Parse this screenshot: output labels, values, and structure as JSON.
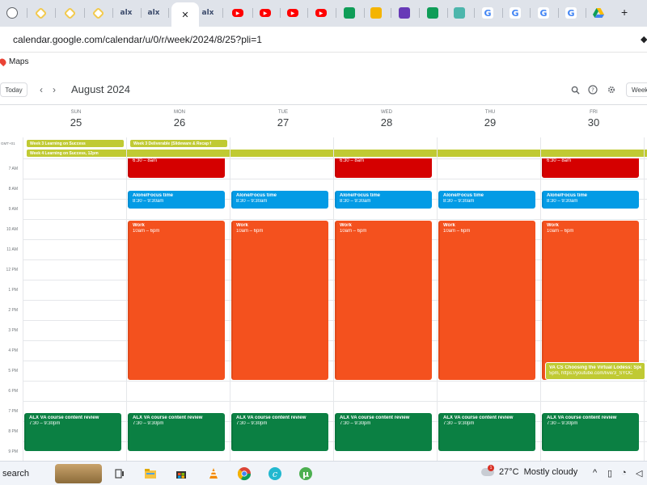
{
  "browser": {
    "url": "calendar.google.com/calendar/u/0/r/week/2024/8/25?pli=1",
    "new_tab_label": "+",
    "active_tab_close": "✕",
    "tabs": [
      {
        "icon": "globe-icon",
        "text": "",
        "color": "#5f6368"
      },
      {
        "icon": "chrome-web-store-icon",
        "text": "",
        "color": "#f2c94c"
      },
      {
        "icon": "chrome-web-store-icon",
        "text": "",
        "color": "#f2c94c"
      },
      {
        "icon": "chrome-web-store-icon",
        "text": "",
        "color": "#f2c94c"
      },
      {
        "icon": "alx-icon",
        "text": "alx",
        "color": "#3b4a6b"
      },
      {
        "icon": "alx-icon",
        "text": "alx",
        "color": "#3b4a6b"
      },
      {
        "icon": "alx-icon",
        "text": "alx",
        "color": "#3b4a6b"
      },
      {
        "icon": "youtube-icon",
        "text": "",
        "color": "#ff0000"
      },
      {
        "icon": "youtube-icon",
        "text": "",
        "color": "#ff0000"
      },
      {
        "icon": "youtube-icon",
        "text": "",
        "color": "#ff0000"
      },
      {
        "icon": "youtube-icon",
        "text": "",
        "color": "#ff0000"
      },
      {
        "icon": "sheets-icon",
        "text": "",
        "color": "#0f9d58"
      },
      {
        "icon": "slides-icon",
        "text": "",
        "color": "#f4b400"
      },
      {
        "icon": "forms-icon",
        "text": "",
        "color": "#673ab7"
      },
      {
        "icon": "sheets-icon",
        "text": "",
        "color": "#0f9d58"
      },
      {
        "icon": "app-icon",
        "text": "",
        "color": "#4db6ac"
      },
      {
        "icon": "google-icon",
        "text": "G",
        "color": "#4285f4"
      },
      {
        "icon": "google-icon",
        "text": "G",
        "color": "#4285f4"
      },
      {
        "icon": "google-icon",
        "text": "G",
        "color": "#4285f4"
      },
      {
        "icon": "google-icon",
        "text": "G",
        "color": "#4285f4"
      },
      {
        "icon": "drive-icon",
        "text": "",
        "color": "#fbbc04"
      }
    ]
  },
  "bookmarks": [
    {
      "label": "Maps",
      "icon": "maps-icon"
    }
  ],
  "calendar": {
    "today_label": "Today",
    "prev_label": "‹",
    "next_label": "›",
    "month_label": "August 2024",
    "view_label": "Week",
    "timezone_label": "GMT+01",
    "days": [
      {
        "dow": "SUN",
        "num": "25"
      },
      {
        "dow": "MON",
        "num": "26"
      },
      {
        "dow": "TUE",
        "num": "27"
      },
      {
        "dow": "WED",
        "num": "28"
      },
      {
        "dow": "THU",
        "num": "29"
      },
      {
        "dow": "FRI",
        "num": "30"
      }
    ],
    "all_day": [
      {
        "title": "Week 3 Learning on Success",
        "start_day": 0,
        "span": 1,
        "row": 0
      },
      {
        "title": "Week 3 Deliverable (Slideware & Recap f",
        "start_day": 1,
        "span": 1,
        "row": 0
      },
      {
        "title": "Week 4 Learning on Success, 12pm",
        "start_day": 0,
        "span": 6.3,
        "row": 1
      }
    ],
    "hours": [
      "7 AM",
      "8 AM",
      "9 AM",
      "10 AM",
      "11 AM",
      "12 PM",
      "1 PM",
      "2 PM",
      "3 PM",
      "4 PM",
      "5 PM",
      "6 PM",
      "7 PM",
      "8 PM",
      "9 PM"
    ],
    "first_hour": 7,
    "events": [
      {
        "title": "Exercise",
        "when": "6:30 – 8am",
        "day": 1,
        "start": 6.5,
        "end": 8,
        "color": "red"
      },
      {
        "title": "Exercise",
        "when": "6:30 – 8am",
        "day": 3,
        "start": 6.5,
        "end": 8,
        "color": "red"
      },
      {
        "title": "Exercise",
        "when": "6:30 – 8am",
        "day": 5,
        "start": 6.5,
        "end": 8,
        "color": "red"
      },
      {
        "title": "Alone/Focus time",
        "when": "8:30 – 9:30am",
        "day": 1,
        "start": 8.5,
        "end": 9.5,
        "color": "blue"
      },
      {
        "title": "Alone/Focus time",
        "when": "8:30 – 9:30am",
        "day": 2,
        "start": 8.5,
        "end": 9.5,
        "color": "blue"
      },
      {
        "title": "Alone/Focus time",
        "when": "8:30 – 9:30am",
        "day": 3,
        "start": 8.5,
        "end": 9.5,
        "color": "blue"
      },
      {
        "title": "Alone/Focus time",
        "when": "8:30 – 9:30am",
        "day": 4,
        "start": 8.5,
        "end": 9.5,
        "color": "blue"
      },
      {
        "title": "Alone/Focus time",
        "when": "8:30 – 9:30am",
        "day": 5,
        "start": 8.5,
        "end": 9.5,
        "color": "blue"
      },
      {
        "title": "Work",
        "when": "10am – 6pm",
        "day": 1,
        "start": 10,
        "end": 18,
        "color": "orange"
      },
      {
        "title": "Work",
        "when": "10am – 6pm",
        "day": 2,
        "start": 10,
        "end": 18,
        "color": "orange"
      },
      {
        "title": "Work",
        "when": "10am – 6pm",
        "day": 3,
        "start": 10,
        "end": 18,
        "color": "orange"
      },
      {
        "title": "Work",
        "when": "10am – 6pm",
        "day": 4,
        "start": 10,
        "end": 18,
        "color": "orange"
      },
      {
        "title": "Work",
        "when": "10am – 6pm",
        "day": 5,
        "start": 10,
        "end": 18,
        "color": "orange"
      },
      {
        "title": "VA CS Choosing the Virtual Lodess: Spe",
        "when": "5pm, https://youtube.com/live/3_SYOC",
        "day": 5,
        "start": 17,
        "end": 18,
        "color": "lime",
        "inset": true
      },
      {
        "title": "ALX VA course content review",
        "when": "7:30 – 9:30pm",
        "day": 0,
        "start": 19.5,
        "end": 21.5,
        "color": "green"
      },
      {
        "title": "ALX VA course content review",
        "when": "7:30 – 9:30pm",
        "day": 1,
        "start": 19.5,
        "end": 21.5,
        "color": "green"
      },
      {
        "title": "ALX VA course content review",
        "when": "7:30 – 9:30pm",
        "day": 2,
        "start": 19.5,
        "end": 21.5,
        "color": "green"
      },
      {
        "title": "ALX VA course content review",
        "when": "7:30 – 9:30pm",
        "day": 3,
        "start": 19.5,
        "end": 21.5,
        "color": "green"
      },
      {
        "title": "ALX VA course content review",
        "when": "7:30 – 9:30pm",
        "day": 4,
        "start": 19.5,
        "end": 21.5,
        "color": "green"
      },
      {
        "title": "ALX VA course content review",
        "when": "7:30 – 9:30pm",
        "day": 5,
        "start": 19.5,
        "end": 21.5,
        "color": "green"
      }
    ]
  },
  "taskbar": {
    "search_label": "search",
    "weather_temp": "27°C",
    "weather_text": "Mostly cloudy",
    "notification_count": "1",
    "apps": [
      "task-view-icon",
      "file-explorer-icon",
      "microsoft-store-icon",
      "vlc-icon",
      "chrome-icon",
      "canva-icon",
      "utorrent-icon"
    ]
  }
}
